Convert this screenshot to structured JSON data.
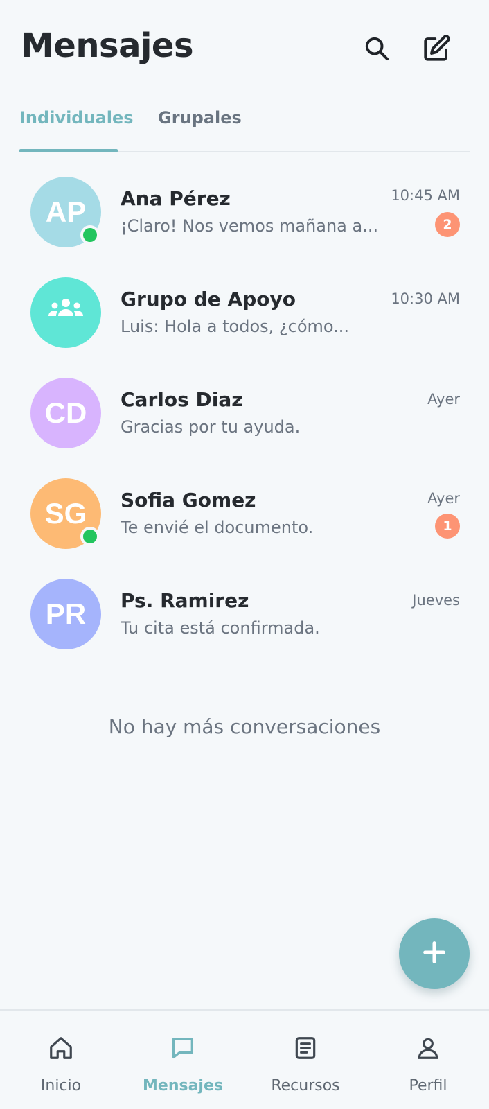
{
  "header": {
    "title": "Mensajes",
    "search_icon": "search-icon",
    "compose_icon": "compose-icon"
  },
  "tabs": [
    {
      "label": "Individuales",
      "active": true
    },
    {
      "label": "Grupales",
      "active": false
    }
  ],
  "conversations": [
    {
      "initials": "AP",
      "name": "Ana Pérez",
      "preview": "¡Claro! Nos vemos mañana a...",
      "time": "10:45 AM",
      "unread": "2",
      "online": true,
      "avatar_color": "#a5dbe6"
    },
    {
      "initials": "",
      "avatar_icon": "group-icon",
      "name": "Grupo de Apoyo",
      "preview": "Luis: Hola a todos, ¿cómo...",
      "time": "10:30 AM",
      "unread": "",
      "online": false,
      "avatar_color": "#5fe6d6"
    },
    {
      "initials": "CD",
      "name": "Carlos Diaz",
      "preview": "Gracias por tu ayuda.",
      "time": "Ayer",
      "unread": "",
      "online": false,
      "avatar_color": "#d8b4fe"
    },
    {
      "initials": "SG",
      "name": "Sofia Gomez",
      "preview": "Te envié el documento.",
      "time": "Ayer",
      "unread": "1",
      "online": true,
      "avatar_color": "#fdba74"
    },
    {
      "initials": "PR",
      "name": "Ps. Ramirez",
      "preview": "Tu cita está confirmada.",
      "time": "Jueves",
      "unread": "",
      "online": false,
      "avatar_color": "#a5b4fc"
    }
  ],
  "end_note": "No hay más conversaciones",
  "fab": {
    "icon": "plus-icon"
  },
  "bottom_nav": [
    {
      "label": "Inicio",
      "icon": "home-icon",
      "active": false
    },
    {
      "label": "Mensajes",
      "icon": "chat-icon",
      "active": true
    },
    {
      "label": "Recursos",
      "icon": "document-icon",
      "active": false
    },
    {
      "label": "Perfil",
      "icon": "profile-icon",
      "active": false
    }
  ],
  "colors": {
    "accent": "#73b6bd",
    "badge": "#fd9474",
    "online": "#22c55e",
    "background": "#f5f8fa"
  }
}
